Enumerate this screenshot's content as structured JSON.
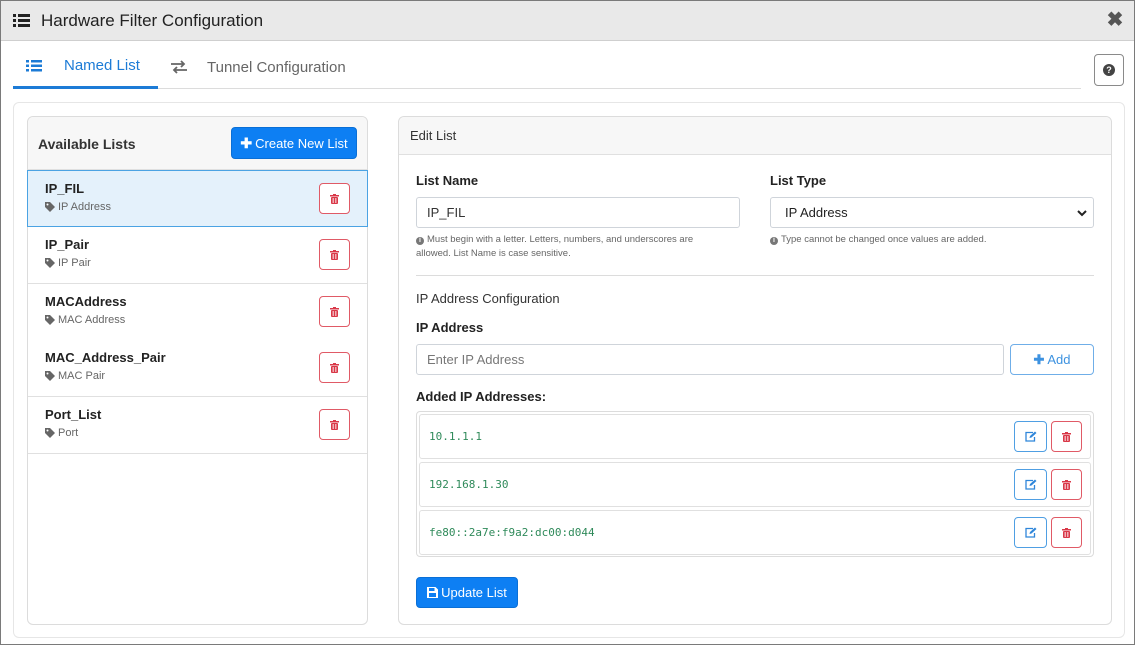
{
  "window": {
    "title": "Hardware Filter Configuration",
    "close_glyph": "✖"
  },
  "tabs": [
    {
      "label": "Named List",
      "icon": "list-icon",
      "active": true
    },
    {
      "label": "Tunnel Configuration",
      "icon": "swap-icon",
      "active": false
    }
  ],
  "help": {
    "icon": "question-circle-icon"
  },
  "available_lists": {
    "title": "Available Lists",
    "create_button": "Create New List",
    "items": [
      {
        "name": "IP_FIL",
        "type": "IP Address",
        "active": true
      },
      {
        "name": "IP_Pair",
        "type": "IP Pair",
        "active": false
      },
      {
        "name": "MACAddress",
        "type": "MAC Address",
        "active": false
      },
      {
        "name": "MAC_Address_Pair",
        "type": "MAC Pair",
        "active": false
      },
      {
        "name": "Port_List",
        "type": "Port",
        "active": false
      }
    ]
  },
  "edit_list": {
    "title": "Edit List",
    "list_name_label": "List Name",
    "list_name_value": "IP_FIL",
    "list_name_hint_line1": "Must begin with a letter. Letters, numbers, and underscores are",
    "list_name_hint_line2": "allowed. List Name is case sensitive.",
    "list_type_label": "List Type",
    "list_type_value": "IP Address",
    "list_type_hint": "Type cannot be changed once values are added.",
    "section_title": "IP Address Configuration",
    "ip_label": "IP Address",
    "ip_placeholder": "Enter IP Address",
    "add_button": "Add",
    "added_label": "Added IP Addresses:",
    "added_ips": [
      "10.1.1.1",
      "192.168.1.30",
      "fe80::2a7e:f9a2:dc00:d044"
    ],
    "update_button": "Update List"
  },
  "colors": {
    "primary": "#0d7ff3",
    "danger": "#e05a66",
    "tab_active": "#1c7bd6",
    "ip_text": "#2f8a5a"
  }
}
